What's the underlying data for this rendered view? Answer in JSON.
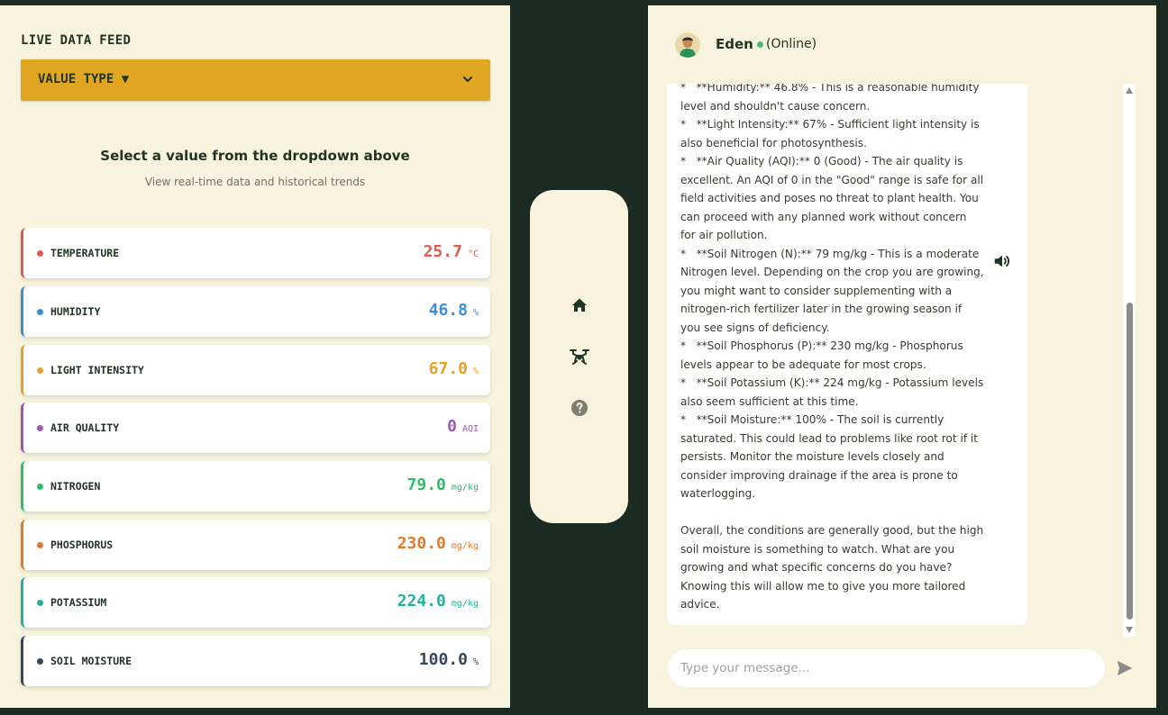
{
  "feed": {
    "title": "LIVE DATA FEED",
    "dropdown_label": "VALUE TYPE ▼",
    "prompt_title": "Select a value from the dropdown above",
    "prompt_subtitle": "View real-time data and historical trends"
  },
  "metrics": [
    {
      "label": "TEMPERATURE",
      "value": "25.7",
      "unit": "°C",
      "color": "#e05a4f"
    },
    {
      "label": "HUMIDITY",
      "value": "46.8",
      "unit": "%",
      "color": "#3d8fd1"
    },
    {
      "label": "LIGHT INTENSITY",
      "value": "67.0",
      "unit": "%",
      "color": "#e6a323"
    },
    {
      "label": "AIR QUALITY",
      "value": "0",
      "unit": "AQI",
      "color": "#9b59b6"
    },
    {
      "label": "NITROGEN",
      "value": "79.0",
      "unit": "mg/kg",
      "color": "#2ebf6a"
    },
    {
      "label": "PHOSPHORUS",
      "value": "230.0",
      "unit": "mg/kg",
      "color": "#e07b2a"
    },
    {
      "label": "POTASSIUM",
      "value": "224.0",
      "unit": "mg/kg",
      "color": "#1fb39a"
    },
    {
      "label": "SOIL MOISTURE",
      "value": "100.0",
      "unit": "%",
      "color": "#34495e"
    }
  ],
  "nav": {
    "icons": [
      "home-icon",
      "drone-icon",
      "help-icon"
    ]
  },
  "chat": {
    "contact_name": "Eden",
    "status": "(Online)",
    "message": "*   **Humidity:** 46.8% - This is a reasonable humidity level and shouldn't cause concern.\n*   **Light Intensity:** 67% - Sufficient light intensity is also beneficial for photosynthesis.\n*   **Air Quality (AQI):** 0 (Good) - The air quality is excellent. An AQI of 0 in the \"Good\" range is safe for all field activities and poses no threat to plant health. You can proceed with any planned work without concern for air pollution.\n*   **Soil Nitrogen (N):** 79 mg/kg - This is a moderate Nitrogen level. Depending on the crop you are growing, you might want to consider supplementing with a nitrogen-rich fertilizer later in the growing season if you see signs of deficiency.\n*   **Soil Phosphorus (P):** 230 mg/kg - Phosphorus levels appear to be adequate for most crops.\n*   **Soil Potassium (K):** 224 mg/kg - Potassium levels also seem sufficient at this time.\n*   **Soil Moisture:** 100% - The soil is currently saturated. This could lead to problems like root rot if it persists. Monitor the moisture levels closely and consider improving drainage if the area is prone to waterlogging.\n\nOverall, the conditions are generally good, but the high soil moisture is something to watch. What are you growing and what specific concerns do you have? Knowing this will allow me to give you more tailored advice.",
    "input_placeholder": "Type your message..."
  }
}
